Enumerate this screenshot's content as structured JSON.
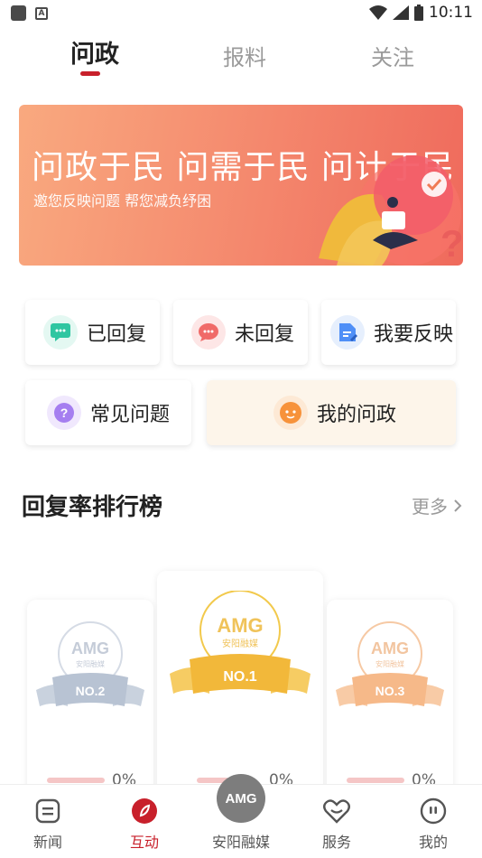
{
  "status": {
    "time": "10:11"
  },
  "tabs": [
    {
      "label": "问政",
      "active": true
    },
    {
      "label": "报料",
      "active": false
    },
    {
      "label": "关注",
      "active": false
    }
  ],
  "banner": {
    "title": "问政于民 问需于民 问计于民",
    "subtitle": "邀您反映问题  帮您减负纾困"
  },
  "actions": [
    {
      "label": "已回复",
      "icon": "chat-bubble-icon",
      "color": "#2fc6a1"
    },
    {
      "label": "未回复",
      "icon": "unreplied-bubble-icon",
      "color": "#f06a68"
    },
    {
      "label": "我要反映",
      "icon": "document-edit-icon",
      "color": "#4f8ff7"
    },
    {
      "label": "常见问题",
      "icon": "question-icon",
      "color": "#a57ef0"
    },
    {
      "label": "我的问政",
      "icon": "my-wenzheng-icon",
      "color": "#f7923a"
    }
  ],
  "ranking": {
    "title": "回复率排行榜",
    "more": "更多",
    "items": [
      {
        "rank": "NO.2",
        "logo": "AMG",
        "logo_sub": "安阳融媒",
        "percent": "0%",
        "color": "#b8c3d3"
      },
      {
        "rank": "NO.1",
        "logo": "AMG",
        "logo_sub": "安阳融媒",
        "percent": "0%",
        "color": "#f2b83a"
      },
      {
        "rank": "NO.3",
        "logo": "AMG",
        "logo_sub": "安阳融媒",
        "percent": "0%",
        "color": "#f6b989"
      }
    ]
  },
  "bottom_nav": [
    {
      "label": "新闻",
      "icon": "news-icon",
      "active": false
    },
    {
      "label": "互动",
      "icon": "interact-icon",
      "active": true
    },
    {
      "label": "安阳融媒",
      "icon": "amg-logo-icon",
      "active": false,
      "badge": "AMG"
    },
    {
      "label": "服务",
      "icon": "service-heart-icon",
      "active": false
    },
    {
      "label": "我的",
      "icon": "profile-icon",
      "active": false
    }
  ],
  "colors": {
    "accent": "#c8202b"
  }
}
